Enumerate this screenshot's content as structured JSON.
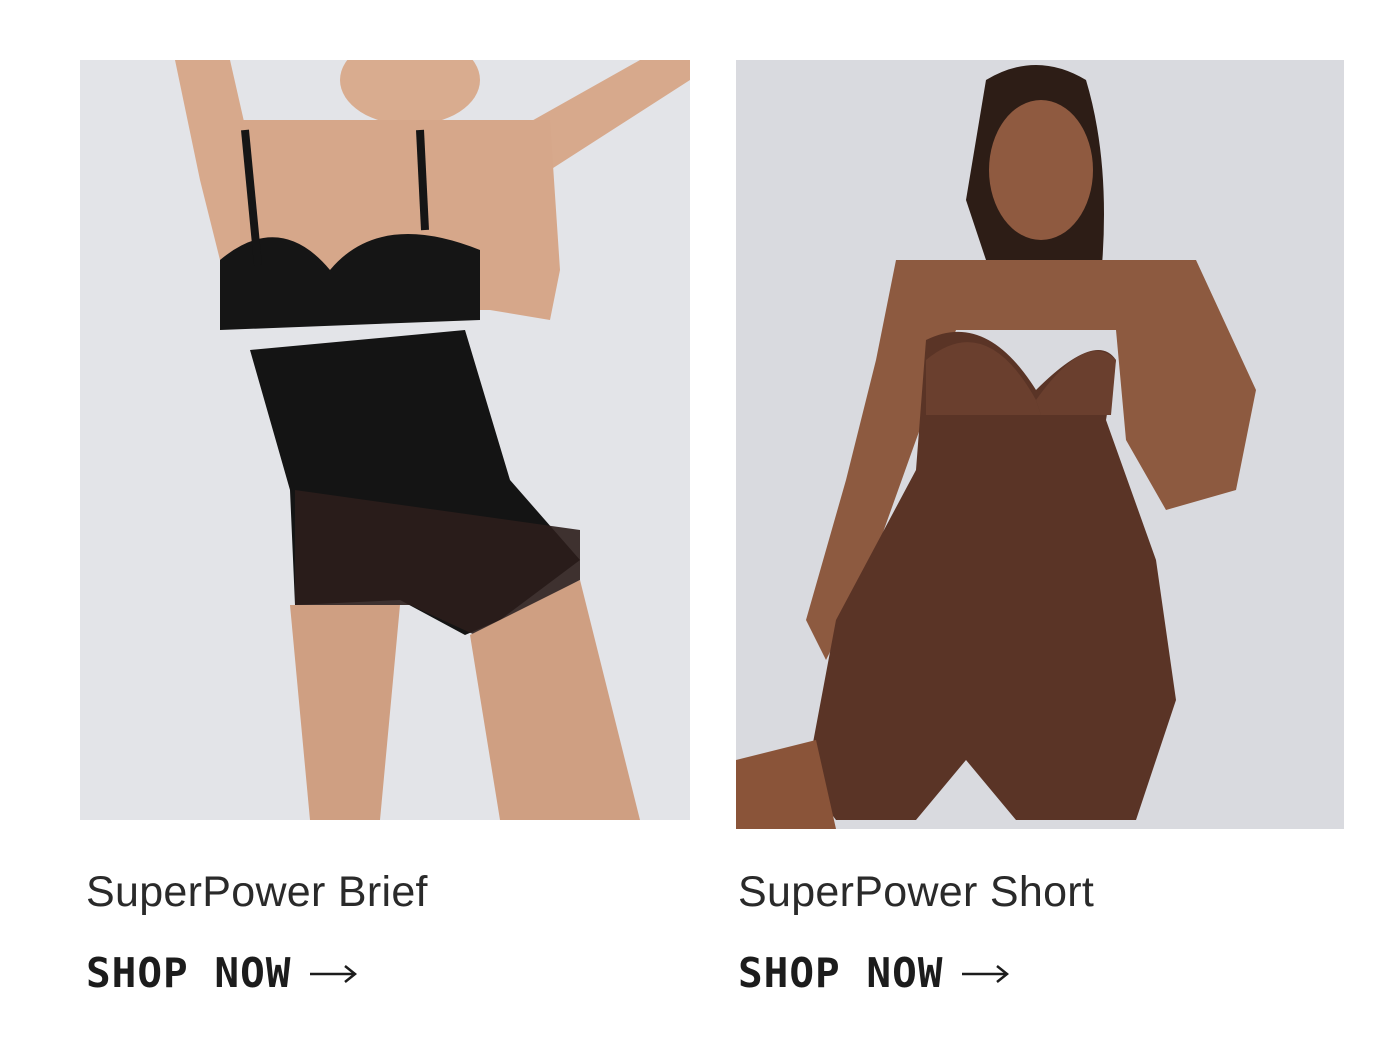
{
  "products": [
    {
      "title": "SuperPower Brief",
      "cta_label": "SHOP NOW",
      "cta_icon": "arrow-right-icon",
      "image_description_colors": {
        "background": "#e3e4e8",
        "garment": "#161616",
        "skin": "#d7a98c"
      }
    },
    {
      "title": "SuperPower Short",
      "cta_label": "SHOP NOW",
      "cta_icon": "arrow-right-icon",
      "image_description_colors": {
        "background": "#d9dadf",
        "garment": "#5a3426",
        "skin": "#8f5a40"
      }
    }
  ]
}
